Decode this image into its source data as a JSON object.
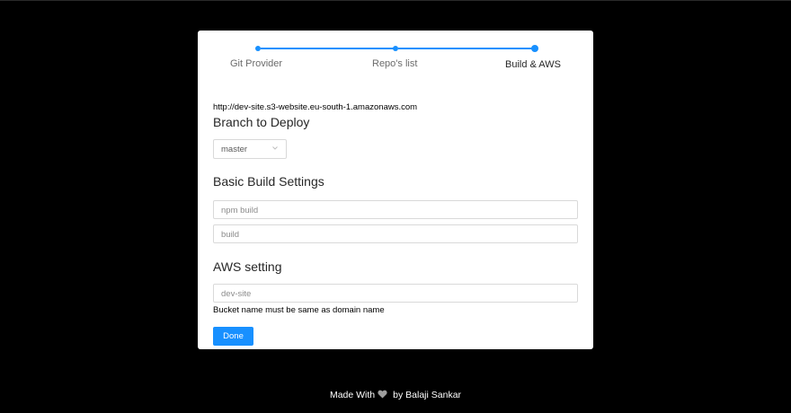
{
  "stepper": {
    "steps": [
      {
        "label": "Git Provider",
        "state": "done"
      },
      {
        "label": "Repo's list",
        "state": "done"
      },
      {
        "label": "Build & AWS",
        "state": "current"
      }
    ],
    "accent_color": "#1890ff"
  },
  "form": {
    "site_url": "http://dev-site.s3-website.eu-south-1.amazonaws.com",
    "branch_title": "Branch to Deploy",
    "branch_select": {
      "value": "master"
    },
    "build_title": "Basic Build Settings",
    "build_command": {
      "placeholder": "npm build"
    },
    "build_output_dir": {
      "placeholder": "build"
    },
    "aws_title": "AWS setting",
    "bucket_name": {
      "placeholder": "dev-site"
    },
    "bucket_hint": "Bucket name must be same as domain name",
    "done_label": "Done"
  },
  "footer": {
    "made_with": "Made With",
    "icon": "heart-icon",
    "by_text": "by Balaji Sankar"
  }
}
